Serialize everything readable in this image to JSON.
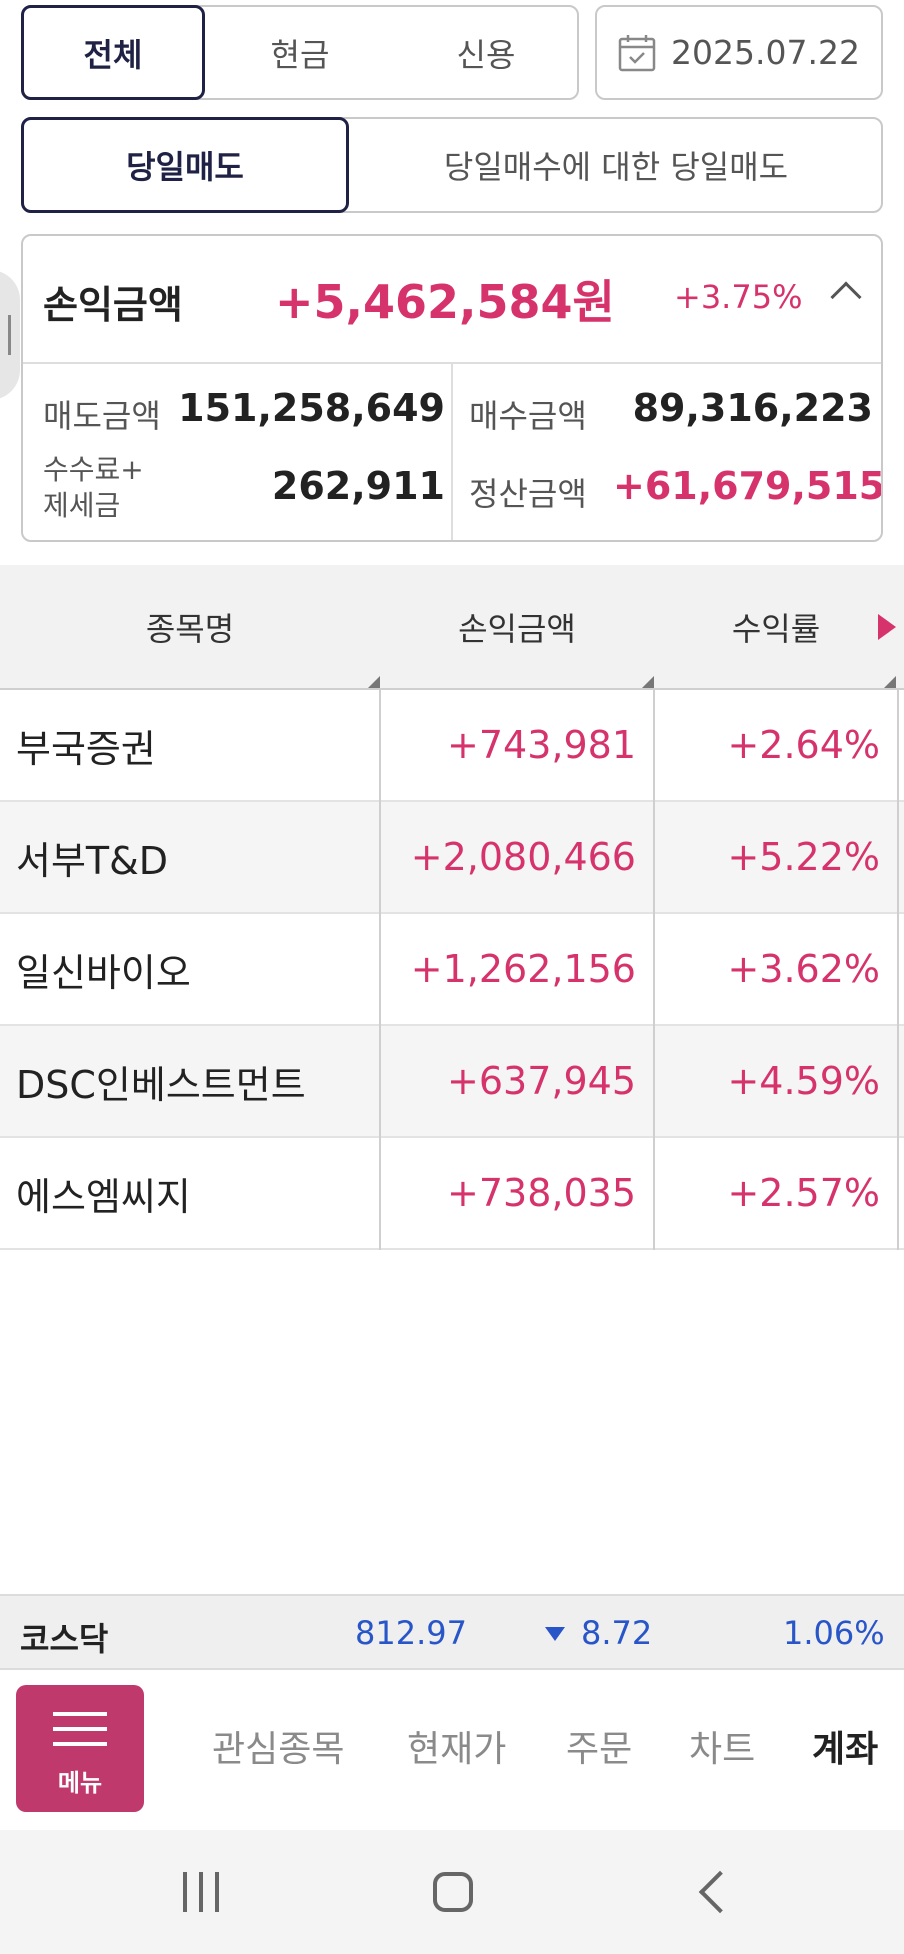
{
  "filter_tabs": {
    "all": "전체",
    "cash": "현금",
    "credit": "신용"
  },
  "date": {
    "value": "2025.07.22"
  },
  "mode_tabs": {
    "sameday_sell": "당일매도",
    "sameday_buy_sell": "당일매수에 대한 당일매도"
  },
  "summary": {
    "title": "손익금액",
    "amount": "+5,462,584원",
    "percent": "+3.75%",
    "sell_label": "매도금액",
    "sell_value": "151,258,649",
    "buy_label": "매수금액",
    "buy_value": "89,316,223",
    "fee_label_line1": "수수료+",
    "fee_label_line2": "제세금",
    "fee_value": "262,911",
    "settle_label": "정산금액",
    "settle_value": "+61,679,515"
  },
  "table": {
    "headers": {
      "name": "종목명",
      "pnl": "손익금액",
      "rate": "수익률"
    },
    "rows": [
      {
        "name": "부국증권",
        "pnl": "+743,981",
        "rate": "+2.64%"
      },
      {
        "name": "서부T&D",
        "pnl": "+2,080,466",
        "rate": "+5.22%"
      },
      {
        "name": "일신바이오",
        "pnl": "+1,262,156",
        "rate": "+3.62%"
      },
      {
        "name": "DSC인베스트먼트",
        "pnl": "+637,945",
        "rate": "+4.59%"
      },
      {
        "name": "에스엠씨지",
        "pnl": "+738,035",
        "rate": "+2.57%"
      }
    ]
  },
  "index_bar": {
    "name": "코스닥",
    "value": "812.97",
    "change": "8.72",
    "change_pct": "1.06%"
  },
  "bottom_nav": {
    "menu": "메뉴",
    "watchlist": "관심종목",
    "quote": "현재가",
    "order": "주문",
    "chart": "차트",
    "account": "계좌"
  },
  "colors": {
    "positive": "#d6336c",
    "negative": "#2855c8",
    "accent": "#c0396c",
    "active_border": "#1f2145"
  }
}
